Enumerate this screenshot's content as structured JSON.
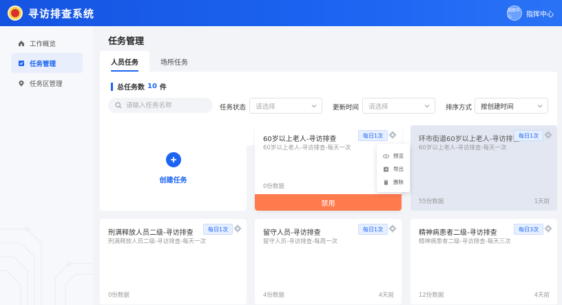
{
  "app": {
    "title": "寻访排查系统"
  },
  "user": {
    "avatar_text": "指挥中心",
    "name": "指挥中心"
  },
  "sidebar": {
    "items": [
      {
        "label": "工作概览",
        "icon": "home-icon",
        "active": false
      },
      {
        "label": "任务管理",
        "icon": "checkbox-icon",
        "active": true
      },
      {
        "label": "任务区管理",
        "icon": "location-pin-icon",
        "active": false
      }
    ]
  },
  "page": {
    "title": "任务管理"
  },
  "tabs": [
    {
      "label": "人员任务",
      "active": true
    },
    {
      "label": "场所任务",
      "active": false
    }
  ],
  "summary": {
    "label": "总任务数",
    "count": "10",
    "unit": "件"
  },
  "filters": {
    "search_placeholder": "请输入任务名称",
    "status_label": "任务状态",
    "status_placeholder": "请选择",
    "updated_label": "更新时间",
    "updated_placeholder": "请选择",
    "sort_label": "排序方式",
    "sort_value": "按创建时间"
  },
  "create": {
    "label": "创建任务"
  },
  "menu": {
    "items": [
      "预览",
      "导出",
      "删除"
    ]
  },
  "disable_label": "禁用",
  "cards": [
    {
      "title": "60岁以上老人-寻访排查",
      "subtitle": "60岁以上老人-寻访排查-每天一次",
      "badge": "每日1次",
      "data": "0份数据",
      "date": ""
    },
    {
      "title": "环市街道60岁以上老人-寻访排查",
      "subtitle": "60岁以上老人-寻访排查-每天一次",
      "badge": "每日1次",
      "data": "55份数据",
      "date": "1天前"
    },
    {
      "title": "刑满释放人员二级-寻访排查",
      "subtitle": "刑满释放人员二级-寻访排查-每天一次",
      "badge": "每日1次",
      "data": "0份数据",
      "date": ""
    },
    {
      "title": "留守人员-寻访排查",
      "subtitle": "留守人员-寻访排查-每周一次",
      "badge": "每日1次",
      "data": "4份数据",
      "date": "4天前"
    },
    {
      "title": "精神病患者二级-寻访排查",
      "subtitle": "精神病患者二级-寻访排查-每天三次",
      "badge": "每日3次",
      "data": "12份数据",
      "date": "4天前"
    }
  ],
  "colors": {
    "primary": "#1c64f2",
    "disable": "#ff7a4d",
    "dimmed_card": "#e2e7f1"
  }
}
